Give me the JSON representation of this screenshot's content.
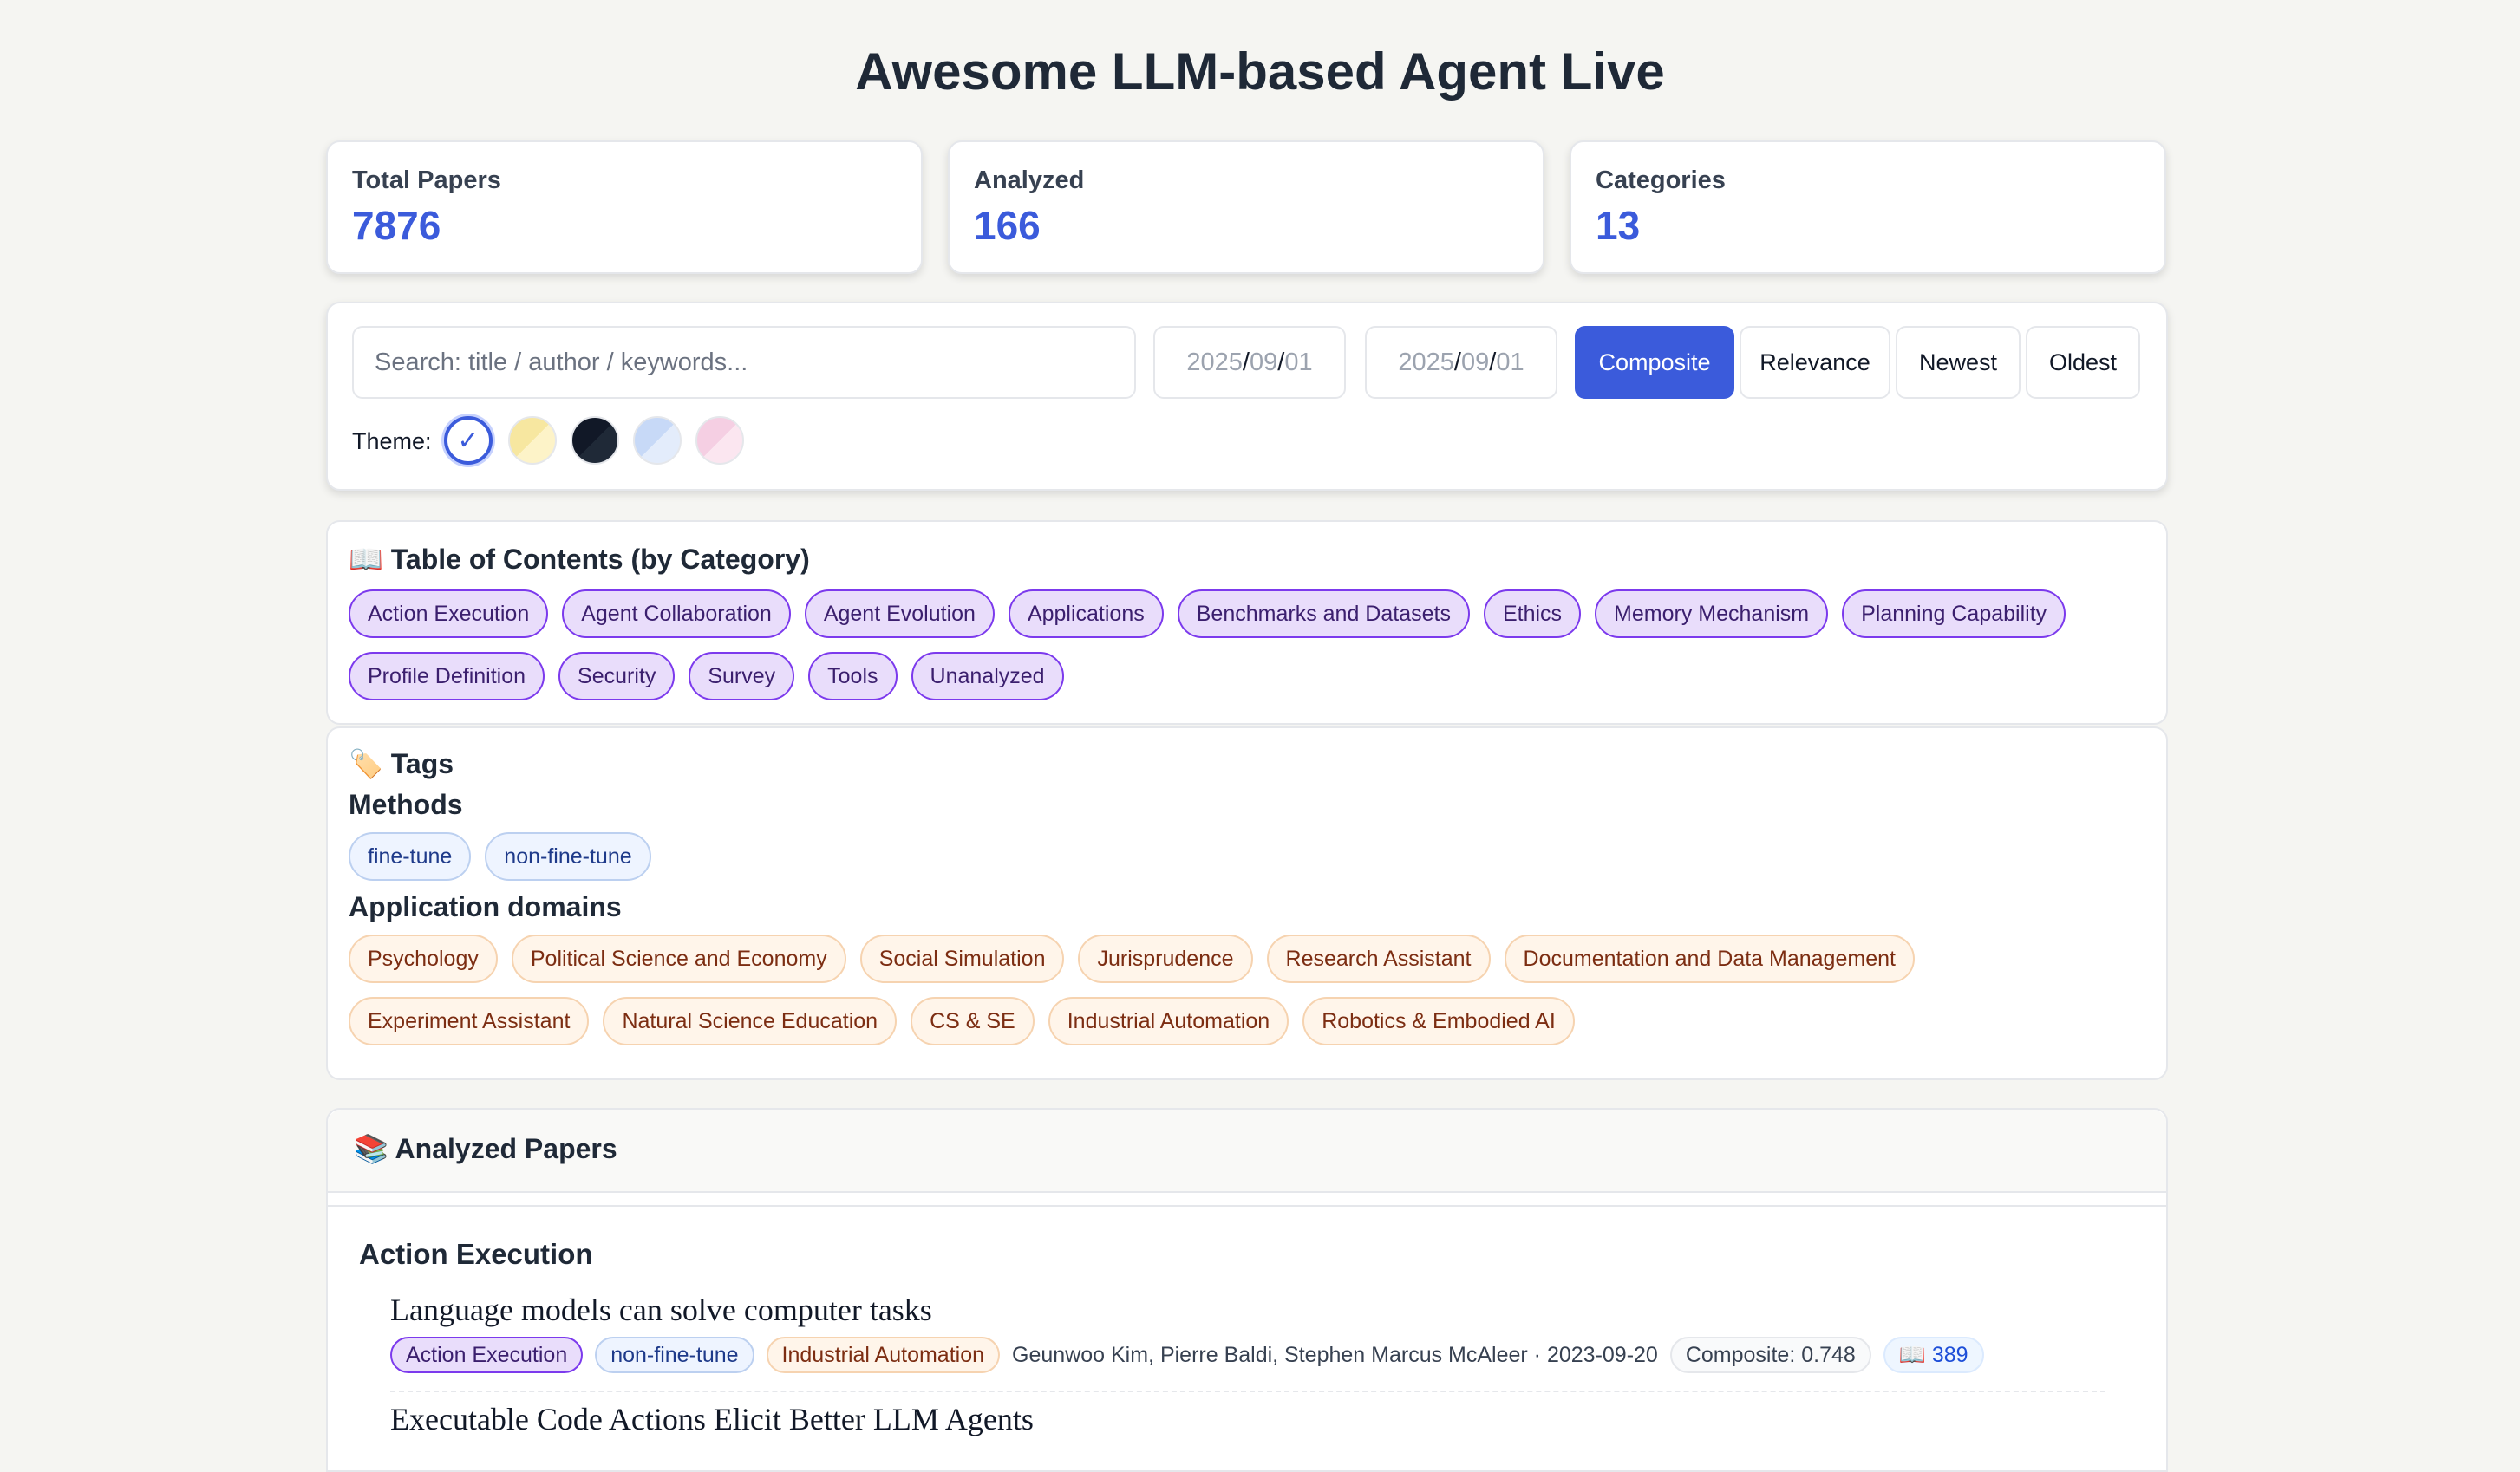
{
  "page_title": "Awesome LLM-based Agent Live",
  "stats": [
    {
      "label": "Total Papers",
      "value": "7876"
    },
    {
      "label": "Analyzed",
      "value": "166"
    },
    {
      "label": "Categories",
      "value": "13"
    }
  ],
  "search": {
    "placeholder": "Search: title / author / keywords..."
  },
  "date_from": {
    "year": "2025",
    "month": "09",
    "day": "01"
  },
  "date_to": {
    "year": "2025",
    "month": "09",
    "day": "01"
  },
  "sort_buttons": [
    "Composite",
    "Relevance",
    "Newest",
    "Oldest"
  ],
  "active_sort": "Composite",
  "theme": {
    "label": "Theme:",
    "check": "✓",
    "swatches": [
      "#ffffff",
      "#f7e7a0",
      "#111827",
      "#c7d9f7",
      "#f5cfe3"
    ],
    "selected": 0
  },
  "toc": {
    "icon": "📖",
    "title": "Table of Contents (by Category)",
    "categories": [
      "Action Execution",
      "Agent Collaboration",
      "Agent Evolution",
      "Applications",
      "Benchmarks and Datasets",
      "Ethics",
      "Memory Mechanism",
      "Planning Capability",
      "Profile Definition",
      "Security",
      "Survey",
      "Tools",
      "Unanalyzed"
    ]
  },
  "tags": {
    "icon": "🏷️",
    "title": "Tags",
    "methods_title": "Methods",
    "methods": [
      "fine-tune",
      "non-fine-tune"
    ],
    "domains_title": "Application domains",
    "domains": [
      "Psychology",
      "Political Science and Economy",
      "Social Simulation",
      "Jurisprudence",
      "Research Assistant",
      "Documentation and Data Management",
      "Experiment Assistant",
      "Natural Science Education",
      "CS & SE",
      "Industrial Automation",
      "Robotics & Embodied AI"
    ]
  },
  "papers": {
    "icon": "📚",
    "title": "Analyzed Papers",
    "section": "Action Execution",
    "items": [
      {
        "title": "Language models can solve computer tasks",
        "category": "Action Execution",
        "method": "non-fine-tune",
        "domain": "Industrial Automation",
        "authors_date": "Geunwoo Kim, Pierre Baldi, Stephen Marcus McAleer · 2023-09-20",
        "score": "Composite: 0.748",
        "citations": "📖 389"
      },
      {
        "title": "Executable Code Actions Elicit Better LLM Agents"
      }
    ]
  }
}
